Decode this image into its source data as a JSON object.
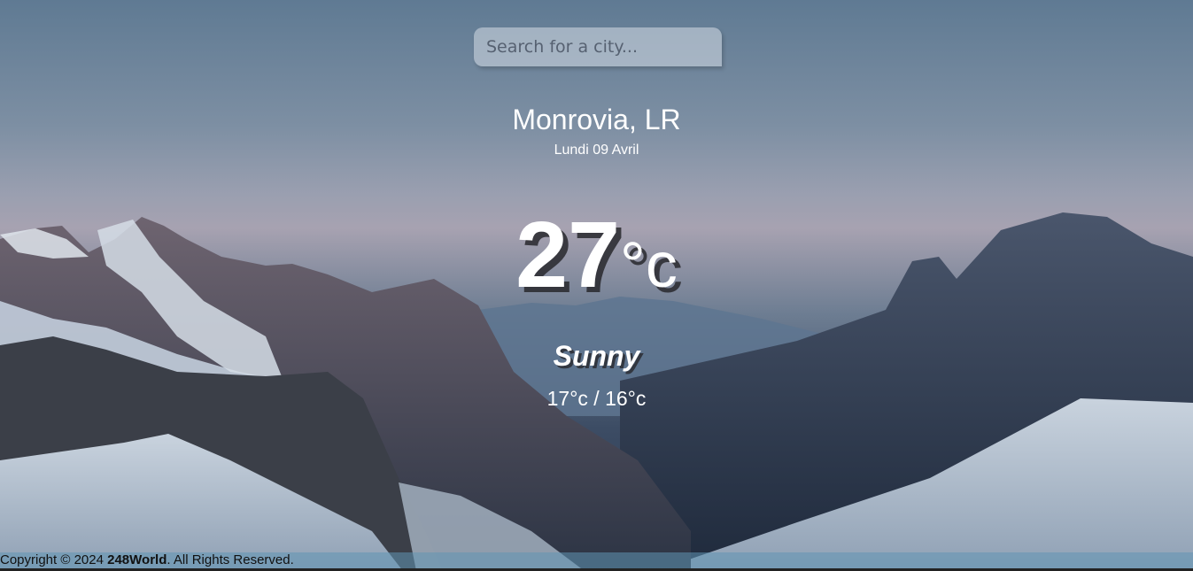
{
  "search": {
    "placeholder": "Search for a city..."
  },
  "weather": {
    "city": "Monrovia, LR",
    "date": "Lundi 09 Avril",
    "temperature": "27",
    "unit": "°c",
    "condition": "Sunny",
    "range": "17°c / 16°c"
  },
  "footer": {
    "prefix": "Copyright © 2024 ",
    "brand": "248World",
    "suffix": ". All Rights Reserved."
  },
  "colors": {
    "text": "#ffffff",
    "sky_top": "#5f7a93",
    "footer_bar": "#6096b4"
  }
}
